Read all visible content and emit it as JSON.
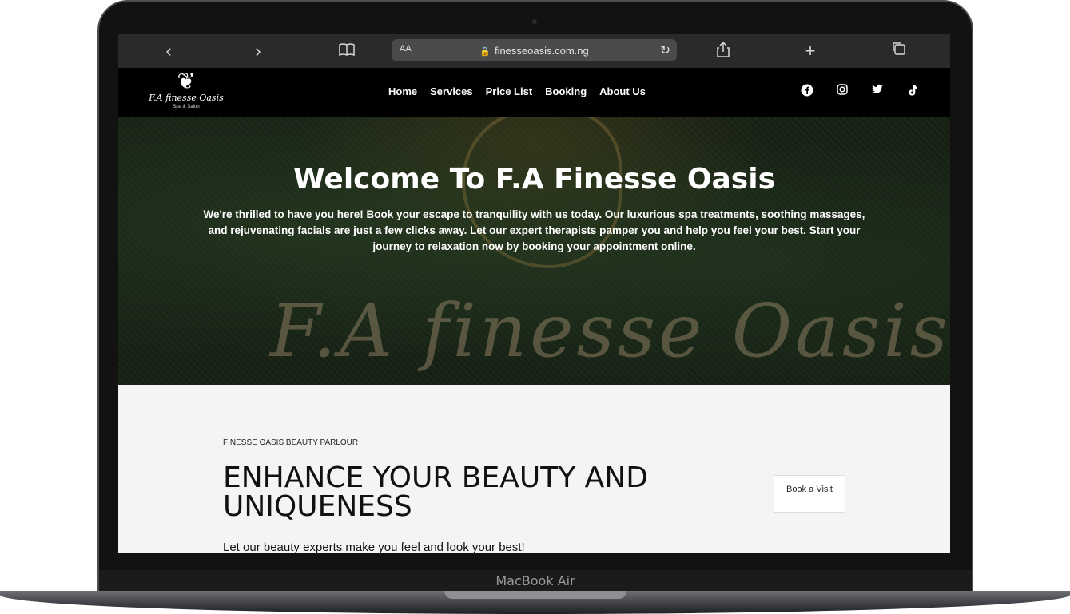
{
  "device": {
    "label": "MacBook Air"
  },
  "browser": {
    "back_icon": "‹",
    "forward_icon": "›",
    "reader_icon": "book-icon",
    "aa_label": "AA",
    "url": "finesseoasis.com.ng",
    "reload_icon": "reload-icon",
    "share_icon": "share-icon",
    "new_tab_icon": "+",
    "tabs_icon": "tabs-icon"
  },
  "site": {
    "logo": {
      "name": "F.A finesse Oasis",
      "sub": "Spa & Salon"
    },
    "nav": [
      "Home",
      "Services",
      "Price List",
      "Booking",
      "About Us"
    ],
    "socials": [
      "facebook",
      "instagram",
      "twitter",
      "tiktok"
    ]
  },
  "hero": {
    "title": "Welcome To F.A Finesse Oasis",
    "text": "We're thrilled to have you here! Book your escape to tranquility with us today. Our luxurious spa treatments, soothing massages, and rejuvenating facials are just a few clicks away. Let our expert therapists pamper you and help you feel your best. Start your journey to relaxation now by booking your appointment online.",
    "sign_text": "F.A finesse Oasis"
  },
  "content": {
    "eyebrow": "FINESSE OASIS BEAUTY PARLOUR",
    "headline": "ENHANCE YOUR BEAUTY AND UNIQUENESS",
    "tagline": "Let our beauty experts make you feel and look your best!",
    "cta": "Book a Visit"
  }
}
